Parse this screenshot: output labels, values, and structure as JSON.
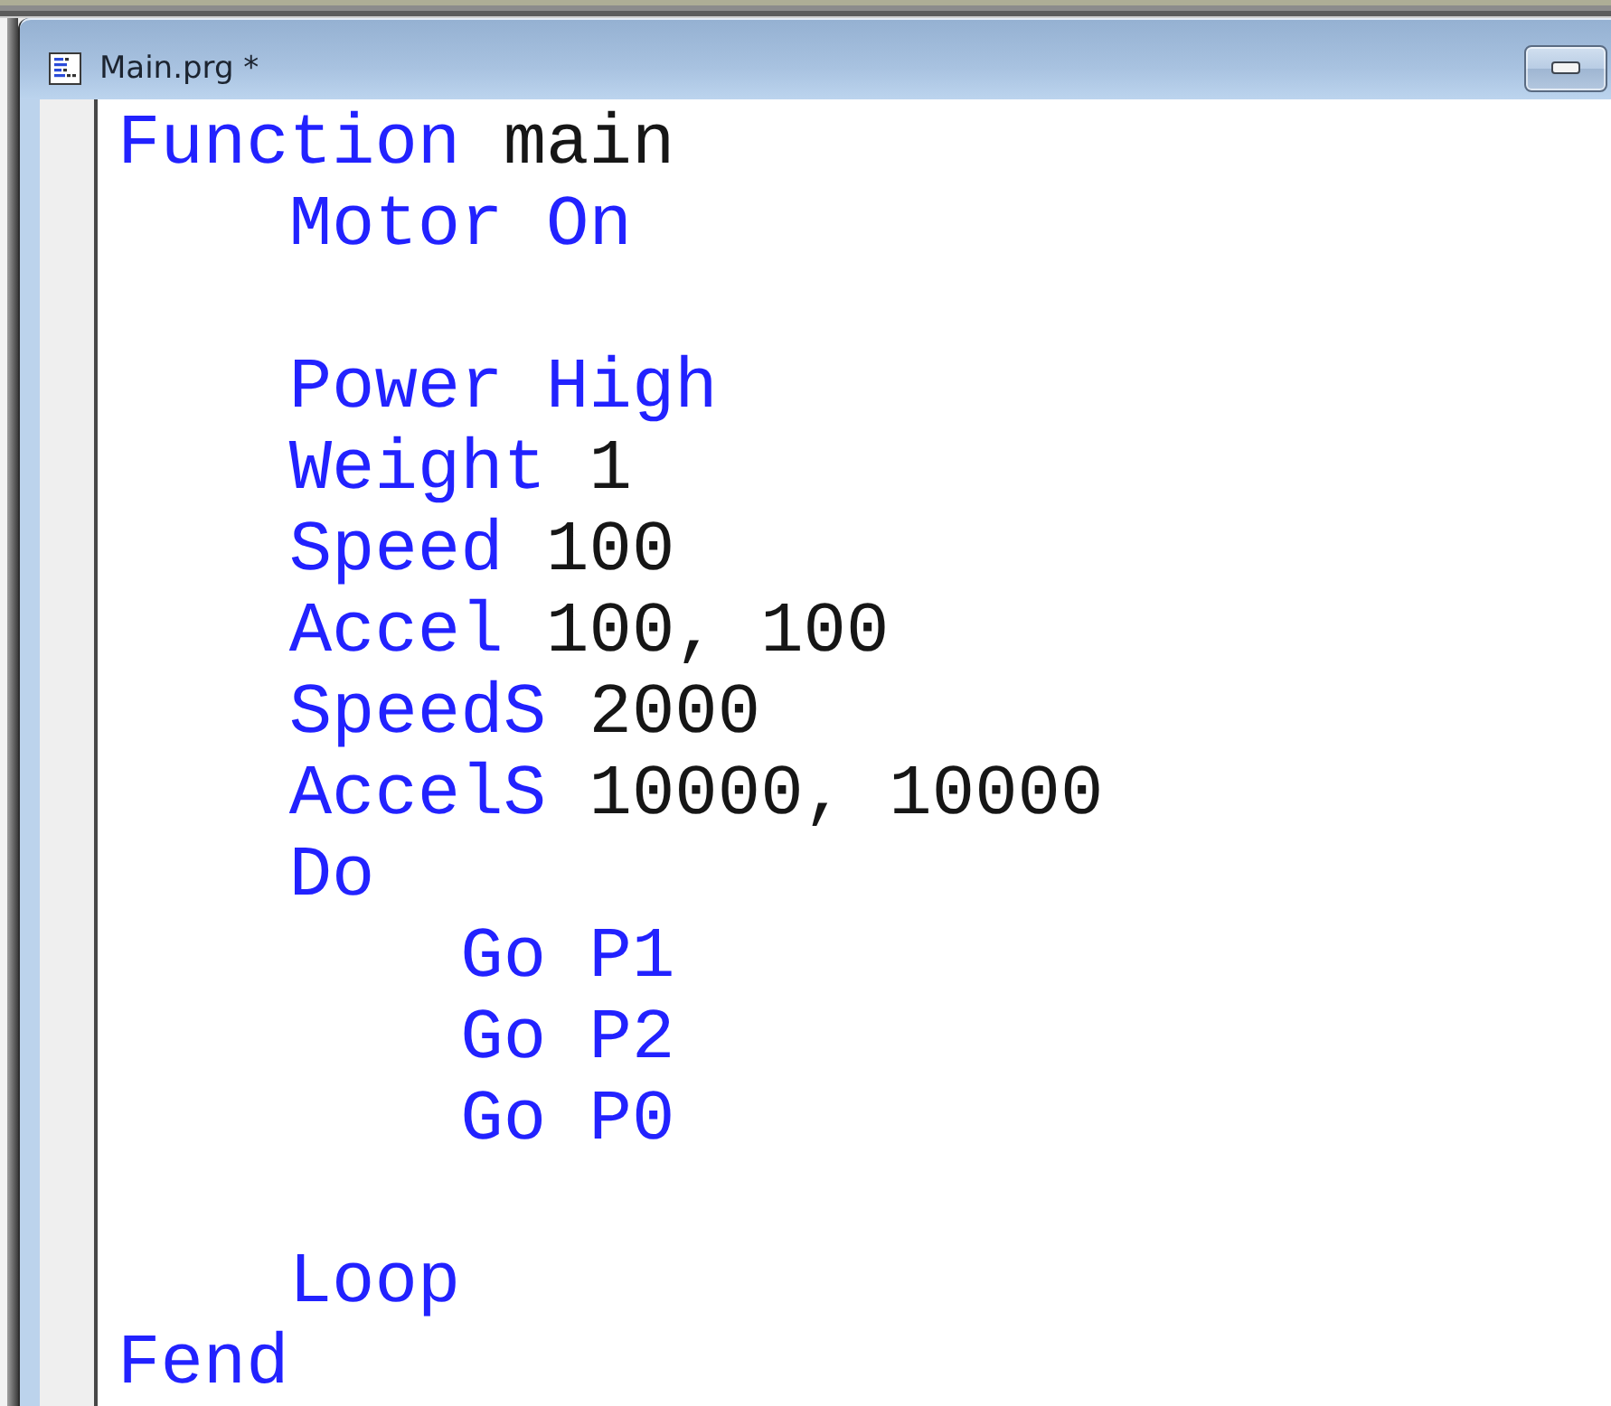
{
  "window": {
    "title": "Main.prg *"
  },
  "code": [
    {
      "kind": "statement",
      "tokens": [
        {
          "text": "Function",
          "kind": "keyword"
        },
        {
          "text": "main",
          "kind": "plain"
        }
      ],
      "children": [
        {
          "kind": "statement",
          "tokens": [
            {
              "text": "Motor On",
              "kind": "keyword"
            }
          ]
        },
        {
          "kind": "blank"
        },
        {
          "kind": "statement",
          "tokens": [
            {
              "text": "Power High",
              "kind": "keyword"
            }
          ]
        },
        {
          "kind": "statement",
          "tokens": [
            {
              "text": "Weight",
              "kind": "keyword"
            },
            {
              "text": "1",
              "kind": "plain"
            }
          ]
        },
        {
          "kind": "statement",
          "tokens": [
            {
              "text": "Speed",
              "kind": "keyword"
            },
            {
              "text": "100",
              "kind": "plain"
            }
          ]
        },
        {
          "kind": "statement",
          "tokens": [
            {
              "text": "Accel",
              "kind": "keyword"
            },
            {
              "text": "100, 100",
              "kind": "plain"
            }
          ]
        },
        {
          "kind": "statement",
          "tokens": [
            {
              "text": "SpeedS",
              "kind": "keyword"
            },
            {
              "text": "2000",
              "kind": "plain"
            }
          ]
        },
        {
          "kind": "statement",
          "tokens": [
            {
              "text": "AccelS",
              "kind": "keyword"
            },
            {
              "text": "10000, 10000",
              "kind": "plain"
            }
          ]
        },
        {
          "kind": "statement",
          "tokens": [
            {
              "text": "Do",
              "kind": "keyword"
            }
          ],
          "children": [
            {
              "kind": "statement",
              "tokens": [
                {
                  "text": "Go P1",
                  "kind": "keyword"
                }
              ]
            },
            {
              "kind": "statement",
              "tokens": [
                {
                  "text": "Go P2",
                  "kind": "keyword"
                }
              ]
            },
            {
              "kind": "statement",
              "tokens": [
                {
                  "text": "Go P0",
                  "kind": "keyword"
                }
              ]
            }
          ]
        },
        {
          "kind": "blank"
        },
        {
          "kind": "statement",
          "tokens": [
            {
              "text": "Loop",
              "kind": "keyword"
            }
          ]
        }
      ]
    },
    {
      "kind": "statement",
      "tokens": [
        {
          "text": "Fend",
          "kind": "keyword"
        }
      ]
    }
  ]
}
